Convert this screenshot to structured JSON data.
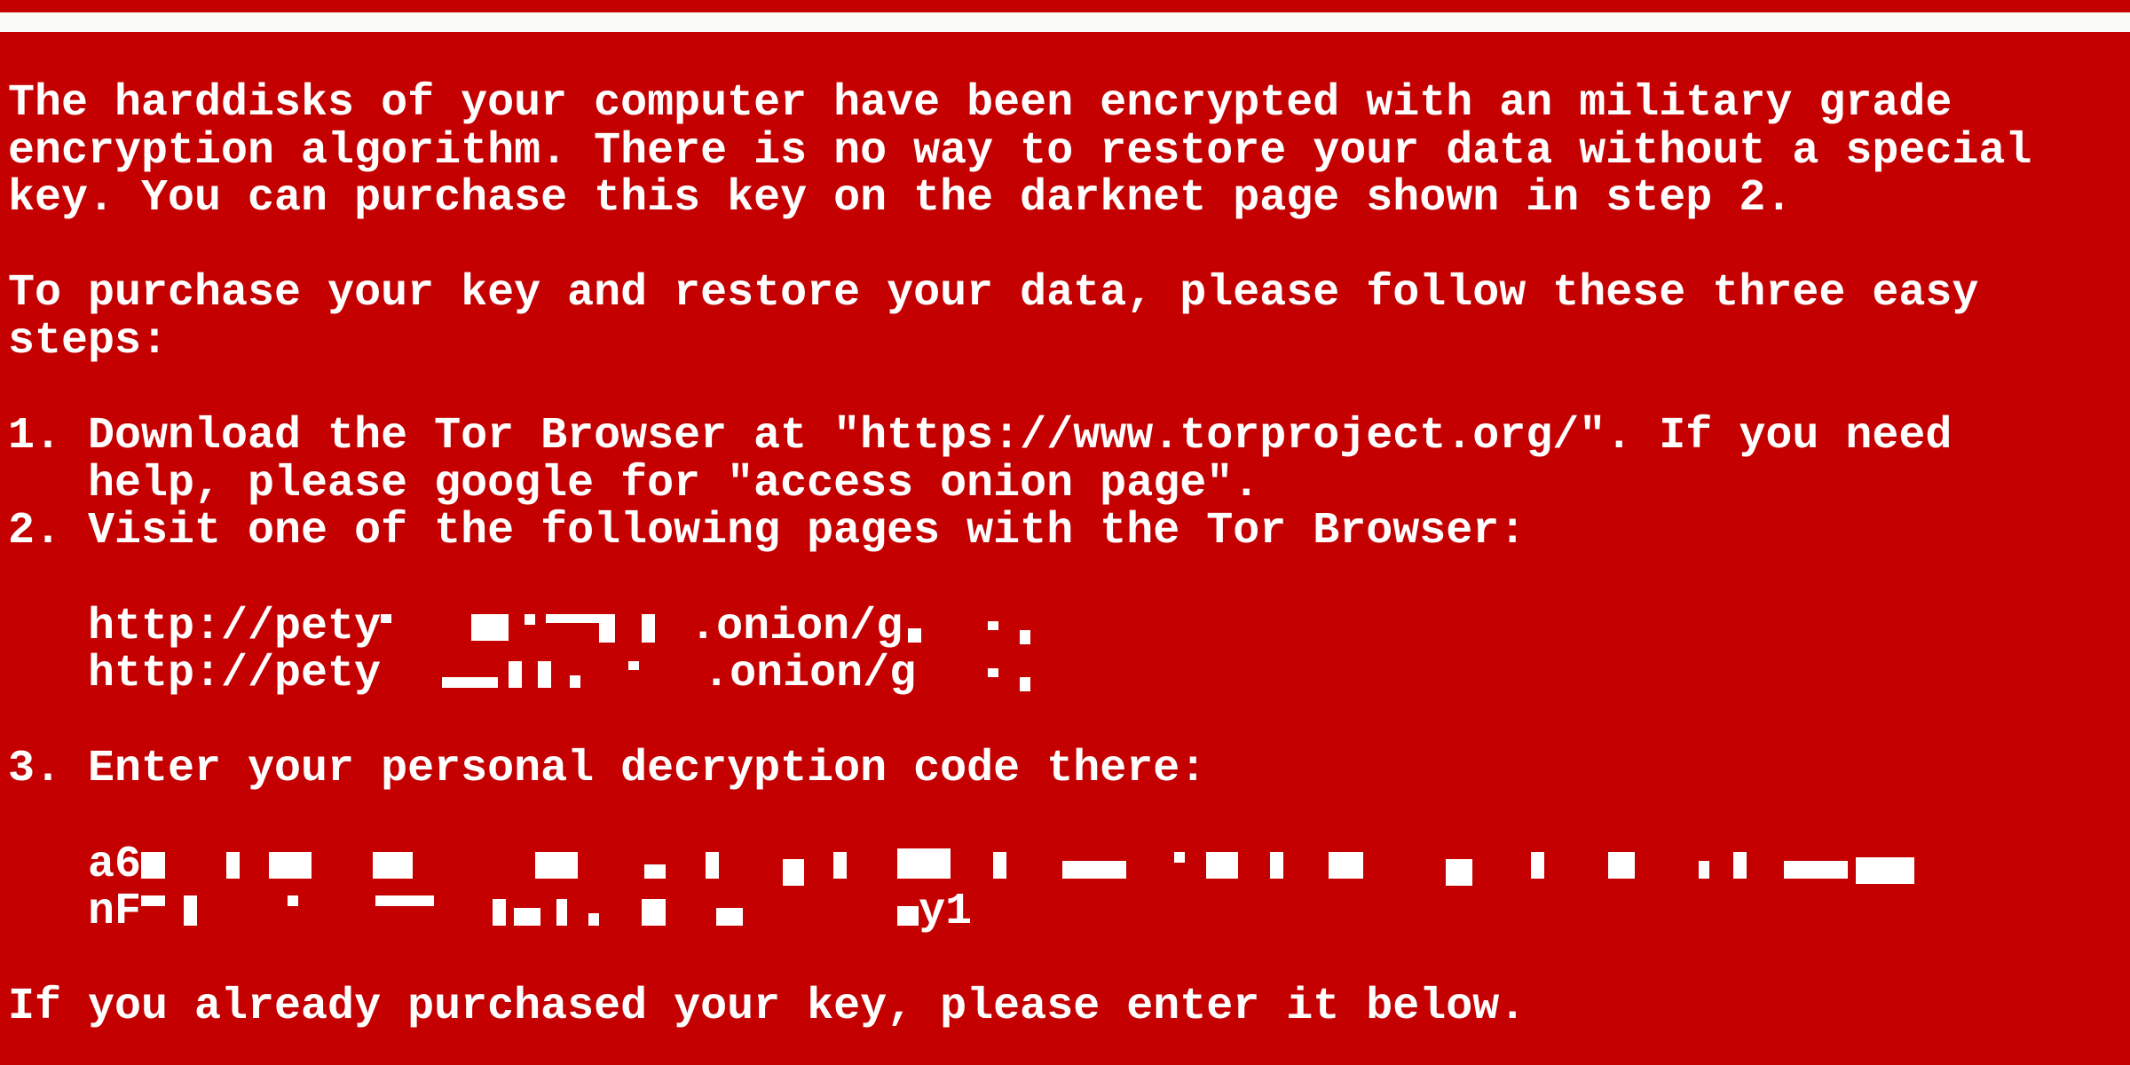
{
  "colors": {
    "background": "#c40000",
    "text": "#ffffff",
    "band": "#fbfbf7"
  },
  "message": {
    "intro": [
      "The harddisks of your computer have been encrypted with an military grade",
      "encryption algorithm. There is no way to restore your data without a special",
      "key. You can purchase this key on the darknet page shown in step 2."
    ],
    "purchase": [
      "To purchase your key and restore your data, please follow these three easy",
      "steps:"
    ],
    "step1": [
      "1. Download the Tor Browser at \"https://www.torproject.org/\". If you need",
      "help, please google for \"access onion page\"."
    ],
    "step2": "2. Visit one of the following pages with the Tor Browser:",
    "urls": [
      {
        "prefix": "http://pety",
        "suffix": ".onion/g"
      },
      {
        "prefix": "http://pety",
        "suffix": ".onion/g"
      }
    ],
    "step3": "3. Enter your personal decryption code there:",
    "code": [
      {
        "prefix": "a6",
        "suffix": ""
      },
      {
        "prefix": "nF",
        "suffix": "y1"
      }
    ],
    "outro": "If you already purchased your key, please enter it below."
  }
}
